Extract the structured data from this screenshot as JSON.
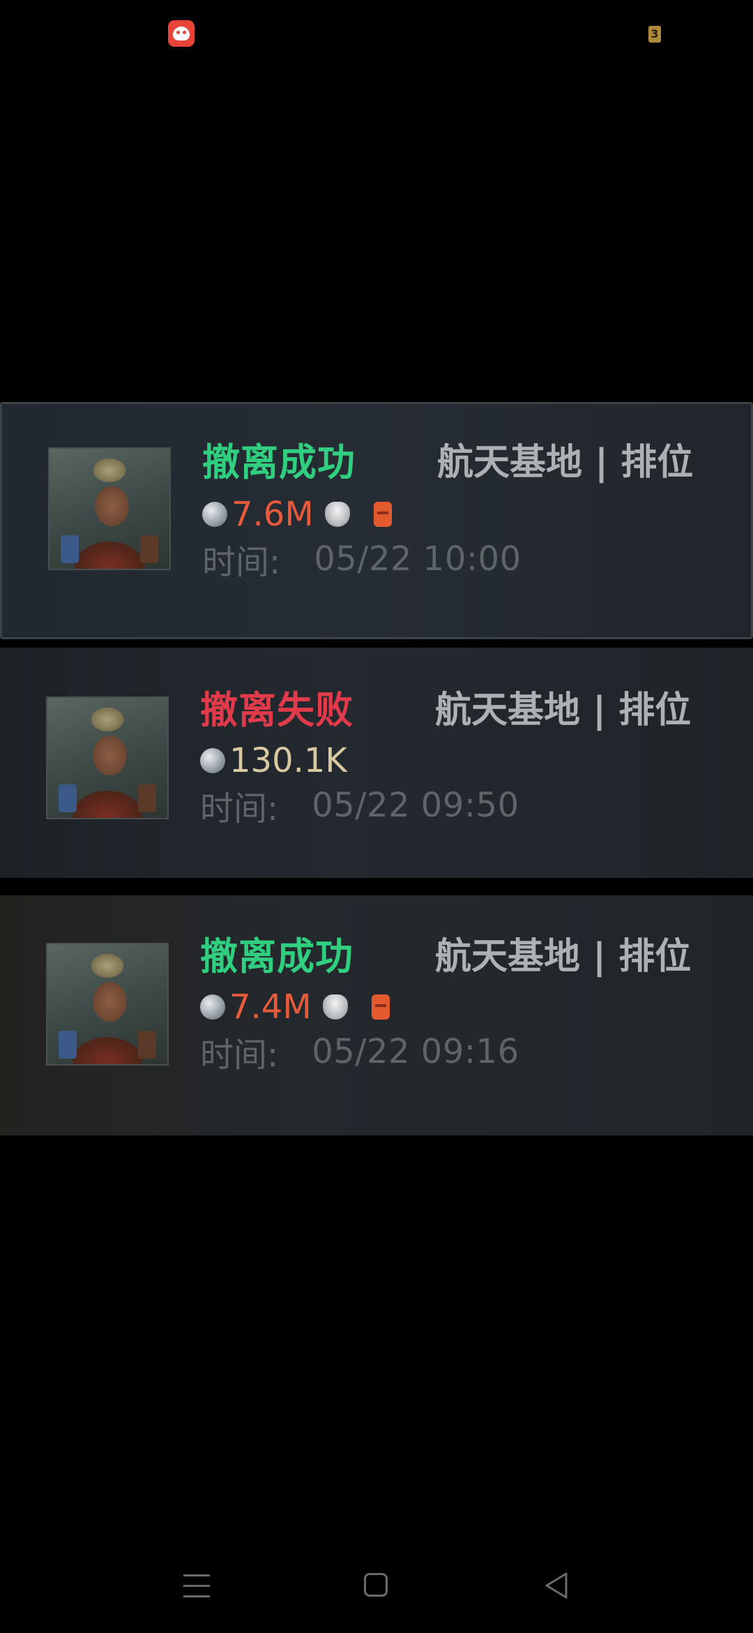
{
  "status_bar": {
    "app_icon": "red-mushroom-app-icon",
    "battery_text": "3"
  },
  "records": [
    {
      "result": "撤离成功",
      "result_type": "success",
      "mode": "航天基地 | 排位",
      "value": "7.6M",
      "value_color": "#e85a3c",
      "has_armor_icon": true,
      "has_pack_icon": true,
      "time_label": "时间:",
      "time_value": "05/22 10:00"
    },
    {
      "result": "撤离失败",
      "result_type": "fail",
      "mode": "航天基地 | 排位",
      "value": "130.1K",
      "value_color": "#d8c9a0",
      "has_armor_icon": false,
      "has_pack_icon": false,
      "time_label": "时间:",
      "time_value": "05/22 09:50"
    },
    {
      "result": "撤离成功",
      "result_type": "success",
      "mode": "航天基地 | 排位",
      "value": "7.4M",
      "value_color": "#e85a3c",
      "has_armor_icon": true,
      "has_pack_icon": true,
      "time_label": "时间:",
      "time_value": "05/22 09:16"
    }
  ],
  "colors": {
    "success": "#2fcf7f",
    "fail": "#e03a4b",
    "mode_text": "#aeb1b4",
    "time_text": "#5e6468"
  },
  "nav_bar": {
    "menu_icon": "menu-icon",
    "home_icon": "home-icon",
    "back_icon": "back-icon"
  }
}
